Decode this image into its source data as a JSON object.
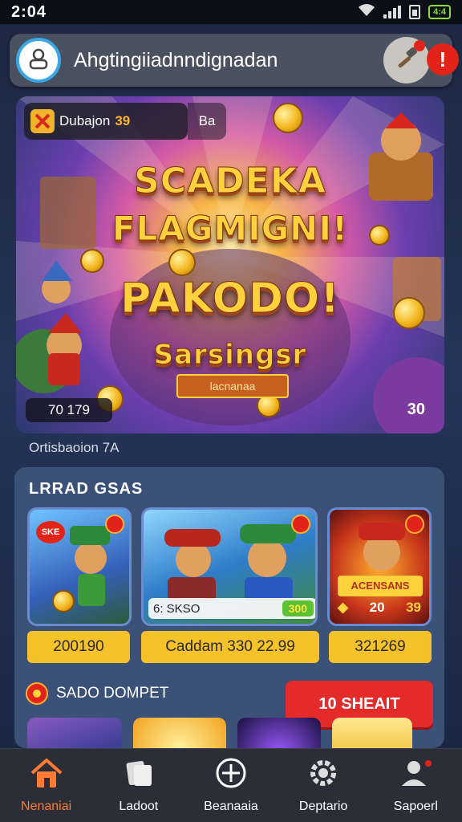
{
  "status_bar": {
    "time": "2:04",
    "battery": "4:4"
  },
  "header": {
    "title": "Ahgtingiiadnndignadan"
  },
  "banner": {
    "tag_text": "Dubajon",
    "tag_coins": "39",
    "tag_extra": "Ba",
    "title_line1": "SCADEKA",
    "title_line2": "FLAGMIGNI!",
    "title_line3": "PAKODO!",
    "title_line4": "Sarsingsr",
    "ribbon": "lacnanaa",
    "left_count": "70 179",
    "right_count": "30"
  },
  "caption": "Ortisbaoion 7A",
  "section": {
    "title": "LRRAD GSAS",
    "cards": [
      {
        "badge": "SKE",
        "price": "200190"
      },
      {
        "strip_left": "6: SKSO",
        "strip_right": "300",
        "price": "Caddam 330 22.99"
      },
      {
        "title": "ACENSANS",
        "left_value": "20",
        "right_value": "39",
        "price": "321269"
      }
    ],
    "sub_title": "SADO DOMPET",
    "action_button": "10 SHEAIT"
  },
  "nav": [
    {
      "label": "Nenaniai",
      "icon": "home-icon"
    },
    {
      "label": "Ladoot",
      "icon": "cards-icon"
    },
    {
      "label": "Beanaaia",
      "icon": "plus-circle-icon"
    },
    {
      "label": "Deptario",
      "icon": "settings-icon"
    },
    {
      "label": "Sapoerl",
      "icon": "user-icon"
    }
  ],
  "colors": {
    "accent_orange": "#ff7a33",
    "gold": "#f6c22a",
    "red": "#e52a2a",
    "panel": "#3b5178"
  }
}
